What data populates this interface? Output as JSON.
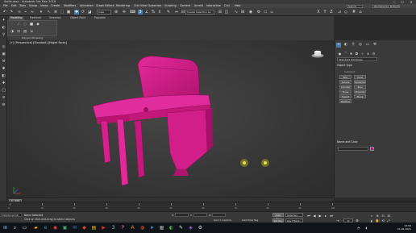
{
  "window": {
    "title": "Sedia.max - Autodesk 3ds Max 2018",
    "controls": [
      "—",
      "☐",
      "✕"
    ]
  },
  "menu": {
    "items": [
      "File",
      "Edit",
      "Tools",
      "Group",
      "Views",
      "Create",
      "Modifiers",
      "Animation",
      "Graph Editors",
      "Rendering",
      "Civil View",
      "Customize",
      "Scripting",
      "Content",
      "Arnold",
      "Interactive",
      "Civil",
      "Help"
    ],
    "sign_in": "Sign In",
    "workspaces_label": "Workspaces: Default"
  },
  "toolbar": {
    "view_dropdown": "View",
    "selection_set": "Create Selection Se"
  },
  "ribbon": {
    "tabs": [
      "Modeling",
      "Freeform",
      "Selection",
      "Object Paint",
      "Populate"
    ],
    "active_tab": "Modeling",
    "panel_label": "Polygon Modeling"
  },
  "viewport": {
    "label": "[+] [Perspective] [Standard] [Edged Faces]",
    "object_color": "#d21a86"
  },
  "command_panel": {
    "dropdown": "Standard Primitives",
    "rollout_object_type": "Object Type",
    "autogrid": "AutoGrid",
    "buttons": [
      "Box",
      "Cone",
      "Sphere",
      "GeoSphere",
      "Cylinder",
      "Tube",
      "Torus",
      "Pyramid",
      "Teapot",
      "Plane",
      "TextPlus"
    ],
    "rollout_name_color": "Name and Color",
    "swatch_color": "#c8197a"
  },
  "timeline": {
    "frame_indicator": "0 / 100",
    "ticks": [
      "0",
      "10",
      "20",
      "30",
      "40",
      "50",
      "60",
      "70",
      "80",
      "90",
      "100"
    ]
  },
  "status": {
    "maxscript": "MAXScript Mi",
    "line1": "None Selected",
    "line2": "Click or click-and-drag to select objects",
    "x_label": "X:",
    "y_label": "Y:",
    "z_label": "Z:",
    "grid": "Grid = 10,0cm",
    "add_time_tag": "Add Time Tag",
    "auto_key": "Auto Key",
    "set_key": "Set Key",
    "selected": "Selected",
    "key_filters": "Key Filters...",
    "frame": "0"
  },
  "taskbar": {
    "time": "13:50",
    "date": "21.05.2021"
  }
}
